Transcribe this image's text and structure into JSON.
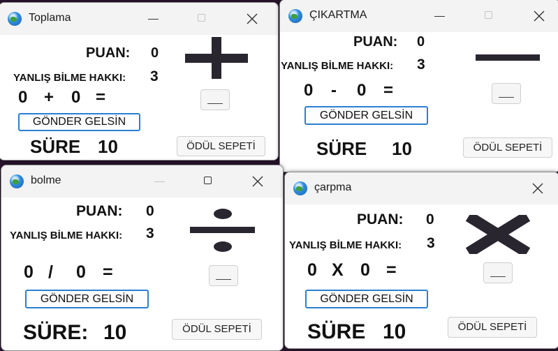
{
  "labels": {
    "puan": "PUAN:",
    "hak": "YANLIŞ BİLME HAKKI:",
    "gonder": "GÖNDER GELSİN",
    "odul": "ÖDÜL SEPETİ",
    "sure": "SÜRE",
    "sure_colon": "SÜRE:"
  },
  "windows": {
    "toplama": {
      "title": "Toplama",
      "score": "0",
      "lives": "3",
      "a": "0",
      "op": "+",
      "b": "0",
      "eq": "=",
      "time": "10",
      "symbol_icon": "plus-icon"
    },
    "cikartma": {
      "title": "ÇIKARTMA",
      "score": "0",
      "lives": "3",
      "a": "0",
      "op": "-",
      "b": "0",
      "eq": "=",
      "time": "10",
      "symbol_icon": "minus-icon"
    },
    "bolme": {
      "title": "bolme",
      "score": "0",
      "lives": "3",
      "a": "0",
      "op": "/",
      "b": "0",
      "eq": "=",
      "time": "10",
      "symbol_icon": "divide-icon"
    },
    "carpma": {
      "title": "çarpma",
      "score": "0",
      "lives": "3",
      "a": "0",
      "op": "X",
      "b": "0",
      "eq": "=",
      "time": "10",
      "symbol_icon": "multiply-icon"
    }
  },
  "colors": {
    "accent_border": "#2a7fd4",
    "symbol": "#2a2630"
  }
}
